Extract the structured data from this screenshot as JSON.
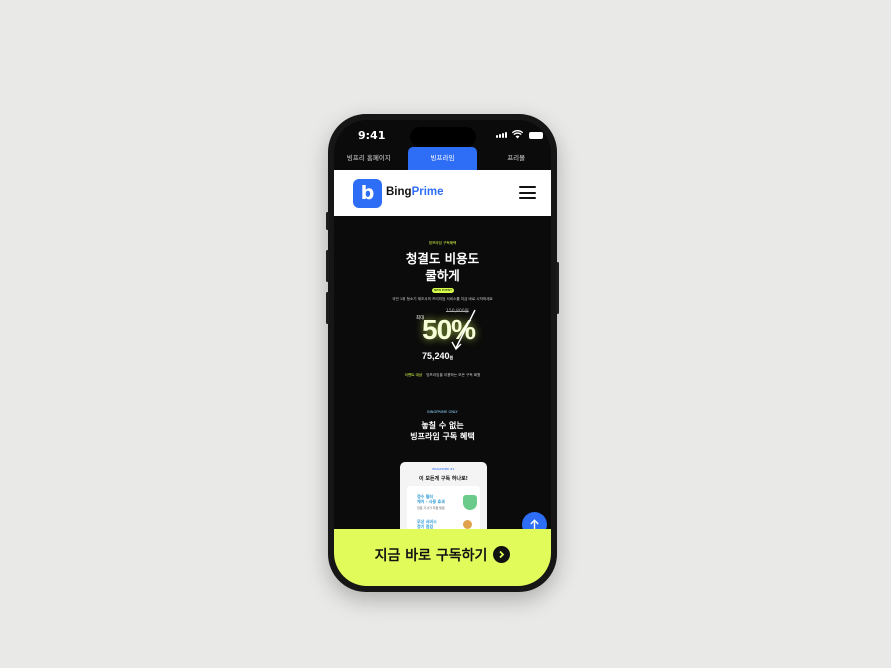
{
  "status_bar": {
    "time": "9:41"
  },
  "tabs": [
    {
      "label": "빙프리 홈페이지",
      "active": false
    },
    {
      "label": "빙프라임",
      "active": true
    },
    {
      "label": "프리몰",
      "active": false
    }
  ],
  "header": {
    "logo_mark": "b",
    "logo_text_1": "Bing",
    "logo_text_2": "Prime",
    "menu_icon": "hamburger-icon"
  },
  "hero": {
    "eyebrow": "빙프라임 구독혜택",
    "title_line1": "청결도 비용도",
    "title_line2": "쿨하게",
    "pill": "NEW EVENT",
    "description": "국민 1위 청소기 제조사의 프리미엄 서비스를 지금 바로 시작하세요",
    "old_price": "150,800원",
    "max_label": "최대",
    "discount": "50%",
    "new_price": "75,240",
    "new_price_unit": "원",
    "foot_highlight": "이벤트 대상",
    "foot_note": "빙프라임을 이용하는 모든 구독 회원"
  },
  "benefits": {
    "eyebrow": "BINGPRIME ONLY",
    "title_line1": "놓칠 수 없는",
    "title_line2": "빙프라임 구독 혜택",
    "card_eyebrow": "BINGPRIME #1",
    "card_title": "이 모든게 구독 하나로!",
    "item1_line1": "정수 필터",
    "item1_line2": "케어 - 사용 효과",
    "item1_sub": "전문 기사가 직접 방문",
    "item2_line1": "무상 서비스",
    "item2_line2": "정기 점검"
  },
  "fab_icon": "arrow-up-icon",
  "cta": {
    "label": "지금 바로 구독하기",
    "icon": "chevron-right-icon"
  },
  "colors": {
    "accent": "#2e6df6",
    "lime": "#e1fb5a",
    "dark": "#0b0b0b"
  }
}
